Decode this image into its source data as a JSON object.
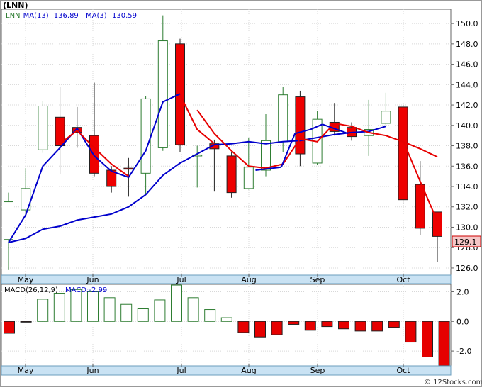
{
  "chart_data": [
    {
      "type": "candlestick",
      "symbol_label": "(LNN)",
      "legend": [
        {
          "label": "LNN",
          "color": "#2e7d32"
        },
        {
          "label": "MA(13)",
          "value": "136.89",
          "color": "#0000cc"
        },
        {
          "label": "MA(3)",
          "value": "130.59",
          "color": "#0000cc"
        }
      ],
      "x_ticks": [
        "May",
        "Jun",
        "Jul",
        "Aug",
        "Sep",
        "Oct"
      ],
      "y_ticks": [
        "150.0",
        "148.0",
        "146.0",
        "144.0",
        "142.0",
        "140.0",
        "138.0",
        "136.0",
        "134.0",
        "132.0",
        "130.0",
        "128.0",
        "126.0"
      ],
      "ylim": [
        125.3,
        151.4
      ],
      "last_price": "129.1",
      "candles": [
        {
          "open": 128.8,
          "close": 132.5,
          "high": 133.4,
          "low": 125.8,
          "up": true
        },
        {
          "open": 131.7,
          "close": 133.8,
          "high": 135.8,
          "low": 131.0,
          "up": true
        },
        {
          "open": 137.6,
          "close": 141.9,
          "high": 142.4,
          "low": 137.3,
          "up": true
        },
        {
          "open": 140.8,
          "close": 138.0,
          "high": 143.8,
          "low": 135.2,
          "up": false
        },
        {
          "open": 139.8,
          "close": 139.3,
          "high": 141.8,
          "low": 137.8,
          "up": false
        },
        {
          "open": 139.0,
          "close": 135.3,
          "high": 144.2,
          "low": 135.0,
          "up": false
        },
        {
          "open": 135.6,
          "close": 134.0,
          "high": 136.0,
          "low": 133.4,
          "up": false
        },
        {
          "open": 135.8,
          "close": 135.8,
          "high": 136.8,
          "low": 133.0,
          "up": false
        },
        {
          "open": 135.3,
          "close": 142.6,
          "high": 142.9,
          "low": 133.2,
          "up": true
        },
        {
          "open": 137.8,
          "close": 148.3,
          "high": 150.8,
          "low": 137.5,
          "up": true
        },
        {
          "open": 148.0,
          "close": 138.1,
          "high": 148.5,
          "low": 137.4,
          "up": false
        },
        {
          "open": 137.1,
          "close": 137.1,
          "high": 138.0,
          "low": 133.9,
          "up": true
        },
        {
          "open": 138.2,
          "close": 137.7,
          "high": 138.6,
          "low": 133.5,
          "up": false
        },
        {
          "open": 137.0,
          "close": 133.4,
          "high": 137.4,
          "low": 132.9,
          "up": false
        },
        {
          "open": 133.8,
          "close": 135.9,
          "high": 138.8,
          "low": 133.7,
          "up": true
        },
        {
          "open": 135.6,
          "close": 138.5,
          "high": 141.1,
          "low": 135.0,
          "up": true
        },
        {
          "open": 138.4,
          "close": 143.0,
          "high": 143.8,
          "low": 137.4,
          "up": true
        },
        {
          "open": 142.8,
          "close": 137.2,
          "high": 143.4,
          "low": 136.0,
          "up": false
        },
        {
          "open": 136.3,
          "close": 140.6,
          "high": 141.4,
          "low": 136.1,
          "up": true
        },
        {
          "open": 140.3,
          "close": 139.4,
          "high": 142.2,
          "low": 139.0,
          "up": false
        },
        {
          "open": 139.8,
          "close": 138.9,
          "high": 140.3,
          "low": 138.5,
          "up": false
        },
        {
          "open": 139.0,
          "close": 139.6,
          "high": 142.5,
          "low": 137.0,
          "up": true
        },
        {
          "open": 140.2,
          "close": 141.4,
          "high": 143.2,
          "low": 139.8,
          "up": true
        },
        {
          "open": 141.8,
          "close": 132.7,
          "high": 142.0,
          "low": 132.3,
          "up": false
        },
        {
          "open": 134.2,
          "close": 129.9,
          "high": 136.5,
          "low": 129.2,
          "up": false
        },
        {
          "open": 131.5,
          "close": 129.1,
          "high": 131.5,
          "low": 126.6,
          "up": false
        }
      ],
      "ma13": [
        {
          "i": 0,
          "v": 128.5
        },
        {
          "i": 1,
          "v": 128.9
        },
        {
          "i": 2,
          "v": 129.8
        },
        {
          "i": 3,
          "v": 130.1
        },
        {
          "i": 4,
          "v": 130.7
        },
        {
          "i": 5,
          "v": 131.0
        },
        {
          "i": 6,
          "v": 131.3
        },
        {
          "i": 7,
          "v": 132.0
        },
        {
          "i": 8,
          "v": 133.2
        },
        {
          "i": 9,
          "v": 135.1
        },
        {
          "i": 10,
          "v": 136.3
        },
        {
          "i": 11,
          "v": 137.2
        },
        {
          "i": 12,
          "v": 138.1
        },
        {
          "i": 13,
          "v": 138.2
        },
        {
          "i": 14,
          "v": 138.4
        },
        {
          "i": 15,
          "v": 138.2
        },
        {
          "i": 16,
          "v": 138.4
        },
        {
          "i": 17,
          "v": 138.5
        },
        {
          "i": 18,
          "v": 138.8
        },
        {
          "i": 19,
          "v": 139.1
        },
        {
          "i": 20,
          "v": 139.3
        },
        {
          "i": 21,
          "v": 139.4
        },
        {
          "i": 22,
          "v": 139.9
        }
      ],
      "ma13_segments": [
        {
          "from_i": 14.4,
          "from_v": 135.6,
          "to_i": 15.9,
          "to_v": 135.9
        },
        {
          "from_i": 15.9,
          "from_v": 135.9,
          "to_i": 16.7,
          "to_v": 139.2
        },
        {
          "from_i": 16.7,
          "from_v": 139.2,
          "to_i": 17.6,
          "to_v": 139.6
        },
        {
          "from_i": 17.6,
          "from_v": 139.6,
          "to_i": 18.3,
          "to_v": 140.1
        },
        {
          "from_i": 18.3,
          "from_v": 140.1,
          "to_i": 19.8,
          "to_v": 139.2
        },
        {
          "from_i": 9.8,
          "from_v": 136.3,
          "to_i": 10.4,
          "to_v": 136.2
        },
        {
          "from_i": 8.2,
          "from_v": 132.5,
          "to_i": 9.2,
          "to_v": 135.1
        }
      ],
      "ma13_path": [
        {
          "i": 0,
          "v": 128.5
        },
        {
          "i": 1,
          "v": 131.2
        },
        {
          "i": 2,
          "v": 136.0
        },
        {
          "i": 3,
          "v": 137.8
        },
        {
          "i": 4,
          "v": 139.7
        },
        {
          "i": 5,
          "v": 137.0
        },
        {
          "i": 6,
          "v": 135.5
        },
        {
          "i": 7,
          "v": 134.9
        },
        {
          "i": 8,
          "v": 137.5
        },
        {
          "i": 9,
          "v": 142.3
        },
        {
          "i": 10,
          "v": 143.1
        }
      ],
      "ma13_path2": [
        {
          "i": 10,
          "v": 135.5
        },
        {
          "i": 11,
          "v": 136.8
        },
        {
          "i": 12,
          "v": 138.2
        },
        {
          "i": 13,
          "v": 138.3
        },
        {
          "i": 14,
          "v": 138.4
        },
        {
          "i": 15,
          "v": 138.2
        },
        {
          "i": 16,
          "v": 138.6
        },
        {
          "i": 17,
          "v": 138.4
        },
        {
          "i": 18,
          "v": 138.9
        },
        {
          "i": 19,
          "v": 139.2
        },
        {
          "i": 20,
          "v": 139.3
        },
        {
          "i": 21,
          "v": 139.7
        },
        {
          "i": 22,
          "v": 140.0
        }
      ],
      "ma3_path": [
        {
          "i": 9,
          "v": 142.3
        },
        {
          "i": 10,
          "v": 143.1
        },
        {
          "i": 11,
          "v": 141.5
        },
        {
          "i": 12,
          "v": 139.2
        },
        {
          "i": 13,
          "v": 137.5
        },
        {
          "i": 14,
          "v": 136.0
        },
        {
          "i": 15,
          "v": 135.8
        },
        {
          "i": 16,
          "v": 136.2
        },
        {
          "i": 17,
          "v": 138.7
        },
        {
          "i": 18,
          "v": 138.4
        },
        {
          "i": 19,
          "v": 140.2
        },
        {
          "i": 20,
          "v": 139.9
        },
        {
          "i": 21,
          "v": 139.3
        },
        {
          "i": 22,
          "v": 139.0
        },
        {
          "i": 23,
          "v": 138.4
        },
        {
          "i": 24,
          "v": 137.7
        },
        {
          "i": 25,
          "v": 136.9
        }
      ],
      "ma3_early": [
        {
          "i": 3,
          "v": 138.2
        },
        {
          "i": 4,
          "v": 139.5
        },
        {
          "i": 5,
          "v": 137.8
        },
        {
          "i": 6,
          "v": 136.2
        },
        {
          "i": 7,
          "v": 135.0
        }
      ],
      "ma3_late": [
        {
          "i": 12,
          "v": 138.0
        },
        {
          "i": 13,
          "v": 136.0
        },
        {
          "i": 14,
          "v": 135.9
        }
      ],
      "ma3_tail": [
        {
          "i": 17,
          "v": 138.5
        },
        {
          "i": 18,
          "v": 138.0
        },
        {
          "i": 19,
          "v": 139.3
        }
      ],
      "ma3_end": [
        {
          "i": 23,
          "v": 138.5
        },
        {
          "i": 24,
          "v": 134.5
        },
        {
          "i": 25,
          "v": 130.6
        }
      ],
      "ma3_mid": [
        {
          "i": 10,
          "v": 143.0
        },
        {
          "i": 11,
          "v": 139.6
        },
        {
          "i": 12,
          "v": 138.2
        }
      ],
      "ma3_color": "#e60000",
      "ma13_color": "#0000cc"
    },
    {
      "type": "bar",
      "legend": [
        {
          "label": "MACD(26,12,9)",
          "color": "#000000"
        },
        {
          "label": "MACD:-2.99",
          "color": "#0000cc"
        }
      ],
      "y_ticks": [
        "2.0",
        "0.0",
        "-2.0"
      ],
      "ylim": [
        -3.0,
        2.5
      ],
      "values": [
        -0.8,
        -0.05,
        1.5,
        1.9,
        2.15,
        2.0,
        1.6,
        1.15,
        0.85,
        1.45,
        2.45,
        1.6,
        0.8,
        0.25,
        -0.75,
        -1.05,
        -0.9,
        -0.2,
        -0.6,
        -0.35,
        -0.5,
        -0.65,
        -0.65,
        -0.4,
        -1.4,
        -2.4,
        -2.99
      ],
      "x_ticks": [
        "May",
        "Jun",
        "Jul",
        "Aug",
        "Sep",
        "Oct"
      ],
      "up_color": "#2e7d32",
      "down_color": "#e60000"
    }
  ],
  "watermark": "© 12Stocks.com"
}
